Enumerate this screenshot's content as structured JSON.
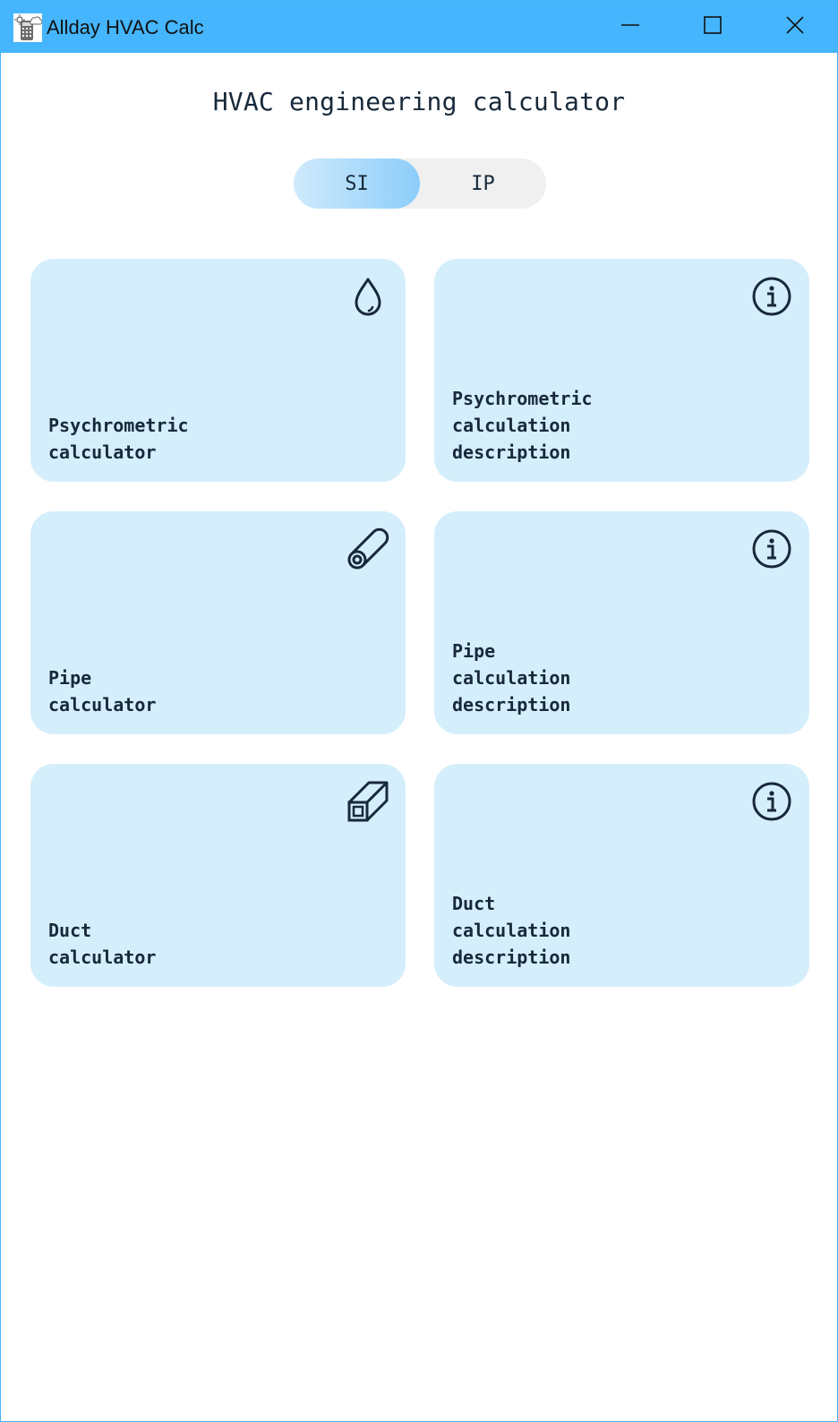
{
  "window": {
    "title": "Allday HVAC Calc",
    "accent_color": "#45b6fd",
    "controls": [
      "minimize-icon",
      "maximize-icon",
      "close-icon"
    ]
  },
  "main": {
    "heading": "HVAC engineering calculator",
    "unit_toggle": {
      "options": [
        "SI",
        "IP"
      ],
      "selected": "SI"
    },
    "cards": [
      {
        "label": "Psychrometric\ncalculator",
        "icon": "water-drop-icon"
      },
      {
        "label": "Psychrometric\ncalculation\ndescription",
        "icon": "info-icon"
      },
      {
        "label": "Pipe\ncalculator",
        "icon": "pipe-icon"
      },
      {
        "label": "Pipe\ncalculation\ndescription",
        "icon": "info-icon"
      },
      {
        "label": "Duct\ncalculator",
        "icon": "duct-icon"
      },
      {
        "label": "Duct\ncalculation\ndescription",
        "icon": "info-icon"
      }
    ],
    "card_color": "#d5eefc",
    "text_color": "#17293a"
  }
}
